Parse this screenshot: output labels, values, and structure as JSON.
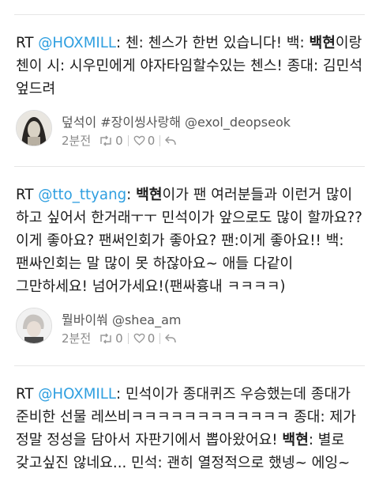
{
  "tweets": [
    {
      "rt": "RT",
      "handle": "@HOXMILL",
      "t1": ": 첸: 첸스가 한번 있습니다! 백: ",
      "bold": "백현",
      "t2": "이랑 첸이 시: 시우민에게 야자타임할수있는 첸스! 종대: 김민석 엎드려",
      "author": "덮석이 #장이씽사랑해 @exol_deopseok",
      "time": "2분전",
      "retweets": "0",
      "likes": "0"
    },
    {
      "rt": "RT",
      "handle": "@tto_ttyang",
      "t1": ": ",
      "bold": "백현",
      "t2": "이가 팬 여러분들과 이런거 많이 하고 싶어서 한거래ㅜㅜ 민석이가 앞으로도 많이 할까요?? 이게 좋아요? 팬써인회가 좋아요? 팬:이게 좋아요!! 백:팬싸인회는 말 많이 못 하잖아요~ 애들 다같이 그만하세요! 넘어가세요!(팬싸흉내 ㅋㅋㅋㅋ)",
      "author": "뭘바이쒀 @shea_am",
      "time": "2분전",
      "retweets": "0",
      "likes": "0"
    },
    {
      "rt": "RT",
      "handle": "@HOXMILL",
      "t1": ": 민석이가 종대퀴즈 우승했는데 종대가 준비한 선물 레쓰비ㅋㅋㅋㅋㅋㅋㅋㅋㅋㅋㅋㅋ 종대: 제가 정말 정성을 담아서 자판기에서 뽑아왔어요! ",
      "bold": "백현",
      "t2": ": 별로 갖고싶진 않네요... 민석: 괜히 열정적으로 했넹~ 에잉~"
    }
  ],
  "colors": {
    "link": "#2f9fe0",
    "meta": "#8a8a8a"
  }
}
